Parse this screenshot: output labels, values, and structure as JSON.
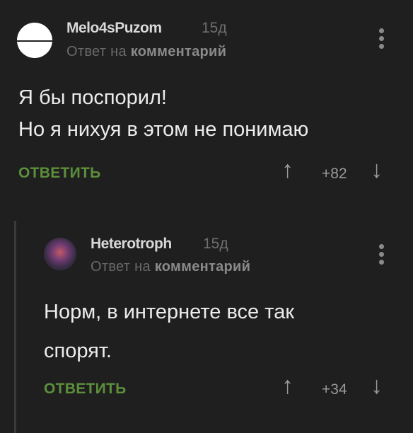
{
  "comments": [
    {
      "author": "Melo4sPuzom",
      "time": "15д",
      "reply_prefix": "Ответ на",
      "reply_target": "комментарий",
      "lines": [
        "Я бы поспорил!",
        "Но я нихуя в этом не понимаю"
      ],
      "action": "ОТВЕТИТЬ",
      "rating": "+82"
    },
    {
      "author": "Heterotroph",
      "time": "15д",
      "reply_prefix": "Ответ на",
      "reply_target": "комментарий",
      "lines": [
        "Норм, в интернете все так",
        "спорят."
      ],
      "action": "ОТВЕТИТЬ",
      "rating": "+34"
    }
  ],
  "icons": {
    "upvote": "↑",
    "downvote": "↓"
  },
  "colors": {
    "background": "#1f1f20",
    "action": "#5c8f3a"
  }
}
